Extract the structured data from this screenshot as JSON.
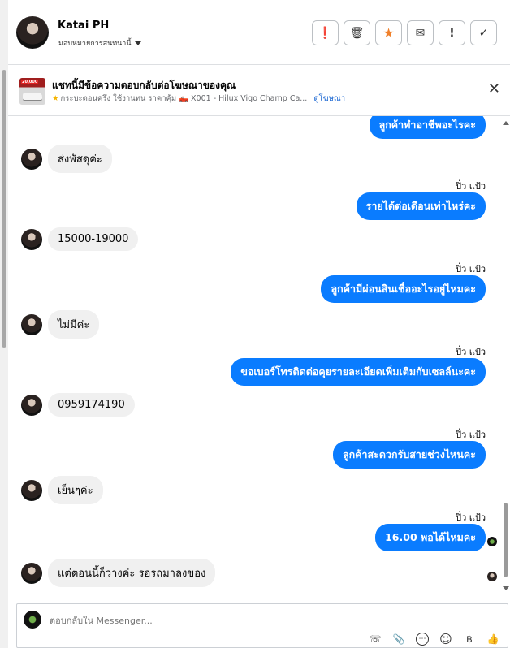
{
  "header": {
    "contact_name": "Katai PH",
    "assign_label": "มอบหมายการสนทนานี้",
    "actions": [
      {
        "name": "report-button",
        "glyph": "❗"
      },
      {
        "name": "delete-button",
        "glyph": "🗑"
      },
      {
        "name": "star-button",
        "glyph": "★"
      },
      {
        "name": "mark-unread-button",
        "glyph": "✉"
      },
      {
        "name": "spam-button",
        "glyph": "!"
      },
      {
        "name": "done-button",
        "glyph": "✓"
      }
    ]
  },
  "ad": {
    "thumb_badge": "20,000",
    "title": "แชทนี้มีข้อความตอบกลับต่อโฆษณาของคุณ",
    "subtitle": "กระบะตอนครึ่ง ใช้งานทน ราคาคุ้ม 🛻 X001 - Hilux Vigo Champ Ca...",
    "view_link": "ดูโฆษณา",
    "close": "✕"
  },
  "conversation": {
    "partial_top": "ลูกค้าทำอาชีพอะไรคะ",
    "messages": [
      {
        "dir": "in",
        "text": "ส่งพัสดุค่ะ"
      },
      {
        "dir": "out",
        "sender": "ปิ่ว แป้ว",
        "text": "รายได้ต่อเดือนเท่าไหร่คะ"
      },
      {
        "dir": "in",
        "text": "15000-19000"
      },
      {
        "dir": "out",
        "sender": "ปิ่ว แป้ว",
        "text": "ลูกค้ามีผ่อนสินเชื่ออะไรอยู่ไหมคะ"
      },
      {
        "dir": "in",
        "text": "ไม่มีค่ะ"
      },
      {
        "dir": "out",
        "sender": "ปิ่ว แป้ว",
        "text": "ขอเบอร์โทรติดต่อคุยรายละเอียดเพิ่มเติมกับเซลล์นะคะ"
      },
      {
        "dir": "in",
        "text": "0959174190"
      },
      {
        "dir": "out",
        "sender": "ปิ่ว แป้ว",
        "text": "ลูกค้าสะดวกรับสายช่วงไหนคะ"
      },
      {
        "dir": "in",
        "text": "เย็นๆค่ะ"
      },
      {
        "dir": "out",
        "sender": "ปิ่ว แป้ว",
        "text": "16.00 พอได้ไหมคะ"
      },
      {
        "dir": "in",
        "text": "แต่ตอนนี้ก็ว่างค่ะ รอรถมาลงของ"
      }
    ]
  },
  "composer": {
    "placeholder": "ตอบกลับใน Messenger...",
    "tools": [
      {
        "name": "call-icon",
        "glyph": "☏"
      },
      {
        "name": "attach-icon",
        "glyph": "📎"
      },
      {
        "name": "saved-replies-icon",
        "glyph": "⋯"
      },
      {
        "name": "emoji-icon",
        "glyph": "☺"
      },
      {
        "name": "payment-icon",
        "glyph": "฿"
      },
      {
        "name": "like-icon",
        "glyph": "👍"
      }
    ]
  }
}
